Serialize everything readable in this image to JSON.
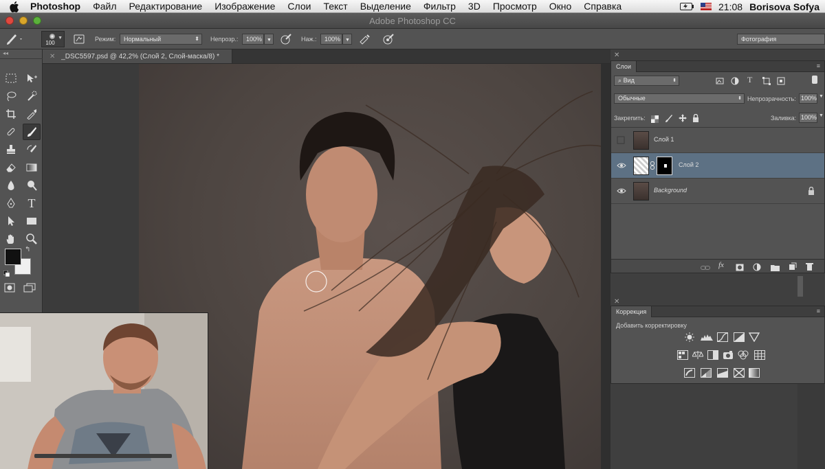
{
  "menubar": {
    "app_name": "Photoshop",
    "items": [
      "Файл",
      "Редактирование",
      "Изображение",
      "Слои",
      "Текст",
      "Выделение",
      "Фильтр",
      "3D",
      "Просмотр",
      "Окно",
      "Справка"
    ],
    "time": "21:08",
    "user": "Borisova Sofya"
  },
  "window": {
    "title": "Adobe Photoshop CC"
  },
  "options_bar": {
    "brush_size": "100",
    "mode_label": "Режим:",
    "mode_value": "Нормальный",
    "opacity_label": "Непрозр.:",
    "opacity_value": "100%",
    "pressure_label": "Наж.:",
    "pressure_value": "100%",
    "workspace": "Фотография"
  },
  "document": {
    "tab_title": "_DSC5597.psd @ 42,2% (Слой 2, Слой-маска/8) *"
  },
  "layers_panel": {
    "tab": "Слои",
    "filter": "Вид",
    "blend_mode": "Обычные",
    "opacity_label": "Непрозрачность:",
    "opacity_value": "100%",
    "lock_label": "Закрепить:",
    "fill_label": "Заливка:",
    "fill_value": "100%",
    "layers": [
      {
        "name": "Слой 1",
        "visible": false,
        "selected": false,
        "has_mask": false
      },
      {
        "name": "Слой 2",
        "visible": true,
        "selected": true,
        "has_mask": true
      },
      {
        "name": "Background",
        "visible": true,
        "selected": false,
        "locked": true
      }
    ]
  },
  "adjustments_panel": {
    "tab": "Коррекция",
    "subtitle": "Добавить корректировку"
  },
  "colors": {
    "ui_panel": "#535353",
    "selection": "#5d7184",
    "foreground": "#111111",
    "background": "#f0f0f0"
  }
}
